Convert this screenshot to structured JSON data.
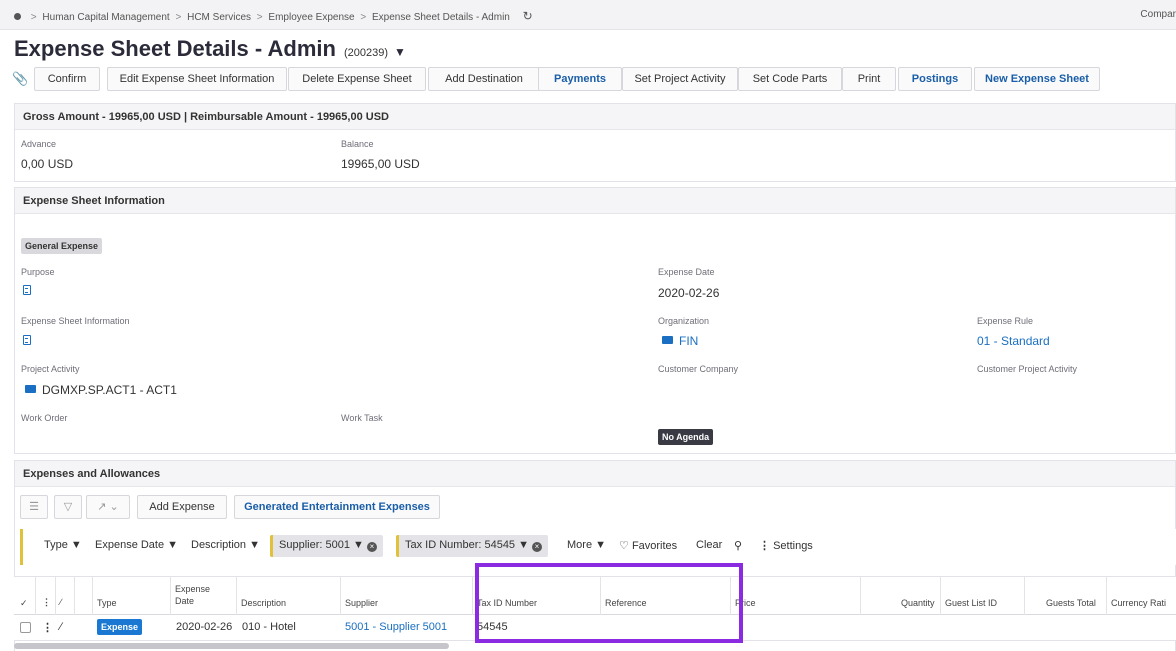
{
  "breadcrumb": {
    "items": [
      "Human Capital Management",
      "HCM Services",
      "Employee Expense",
      "Expense Sheet Details - Admin"
    ],
    "separator": ">",
    "company": "Compar"
  },
  "header": {
    "title": "Expense Sheet Details - Admin",
    "record_id": "(200239)"
  },
  "toolbar": {
    "confirm": "Confirm",
    "edit_info": "Edit Expense Sheet Information",
    "delete_sheet": "Delete Expense Sheet",
    "add_destination": "Add Destination",
    "payments": "Payments",
    "set_project_activity": "Set Project Activity",
    "set_code_parts": "Set Code Parts",
    "print": "Print",
    "postings": "Postings",
    "new_sheet": "New Expense Sheet"
  },
  "amounts": {
    "header": "Gross Amount - 19965,00 USD | Reimbursable Amount - 19965,00 USD",
    "advance_label": "Advance",
    "advance_value": "0,00 USD",
    "balance_label": "Balance",
    "balance_value": "19965,00 USD"
  },
  "info": {
    "header": "Expense Sheet Information",
    "category_badge": "General Expense",
    "purpose_label": "Purpose",
    "expense_date_label": "Expense Date",
    "expense_date_value": "2020-02-26",
    "sheet_info_label": "Expense Sheet Information",
    "organization_label": "Organization",
    "organization_value": "FIN",
    "expense_rule_label": "Expense Rule",
    "expense_rule_value": "01 - Standard",
    "project_activity_label": "Project Activity",
    "project_activity_value": "DGMXP.SP.ACT1 - ACT1",
    "customer_company_label": "Customer Company",
    "customer_project_activity_label": "Customer Project Activity",
    "work_order_label": "Work Order",
    "work_task_label": "Work Task",
    "agenda_badge": "No Agenda"
  },
  "expenses": {
    "header": "Expenses and Allowances",
    "add_expense": "Add Expense",
    "generated_entertainment": "Generated Entertainment Expenses",
    "filters": {
      "type": "Type",
      "expense_date": "Expense Date",
      "description": "Description",
      "supplier_chip": "Supplier: 5001",
      "tax_id_chip": "Tax ID Number: 54545",
      "more": "More",
      "favorites": "Favorites",
      "clear": "Clear",
      "settings": "Settings"
    },
    "columns": {
      "type": "Type",
      "expense_date_1": "Expense",
      "expense_date_2": "Date",
      "description": "Description",
      "supplier": "Supplier",
      "tax_id": "Tax ID Number",
      "reference": "Reference",
      "price": "Price",
      "quantity": "Quantity",
      "guest_list_id": "Guest List ID",
      "guests_total": "Guests Total",
      "currency_rate": "Currency Rati"
    },
    "rows": [
      {
        "type": "Expense",
        "expense_date": "2020-02-26",
        "description": "010 - Hotel",
        "supplier": "5001 - Supplier 5001",
        "tax_id": "54545"
      }
    ]
  },
  "colors": {
    "accent_blue": "#1a78d2",
    "link_blue": "#1a6fc2",
    "filter_yellow": "#e0c13a",
    "highlight_purple": "#8a2be2"
  }
}
